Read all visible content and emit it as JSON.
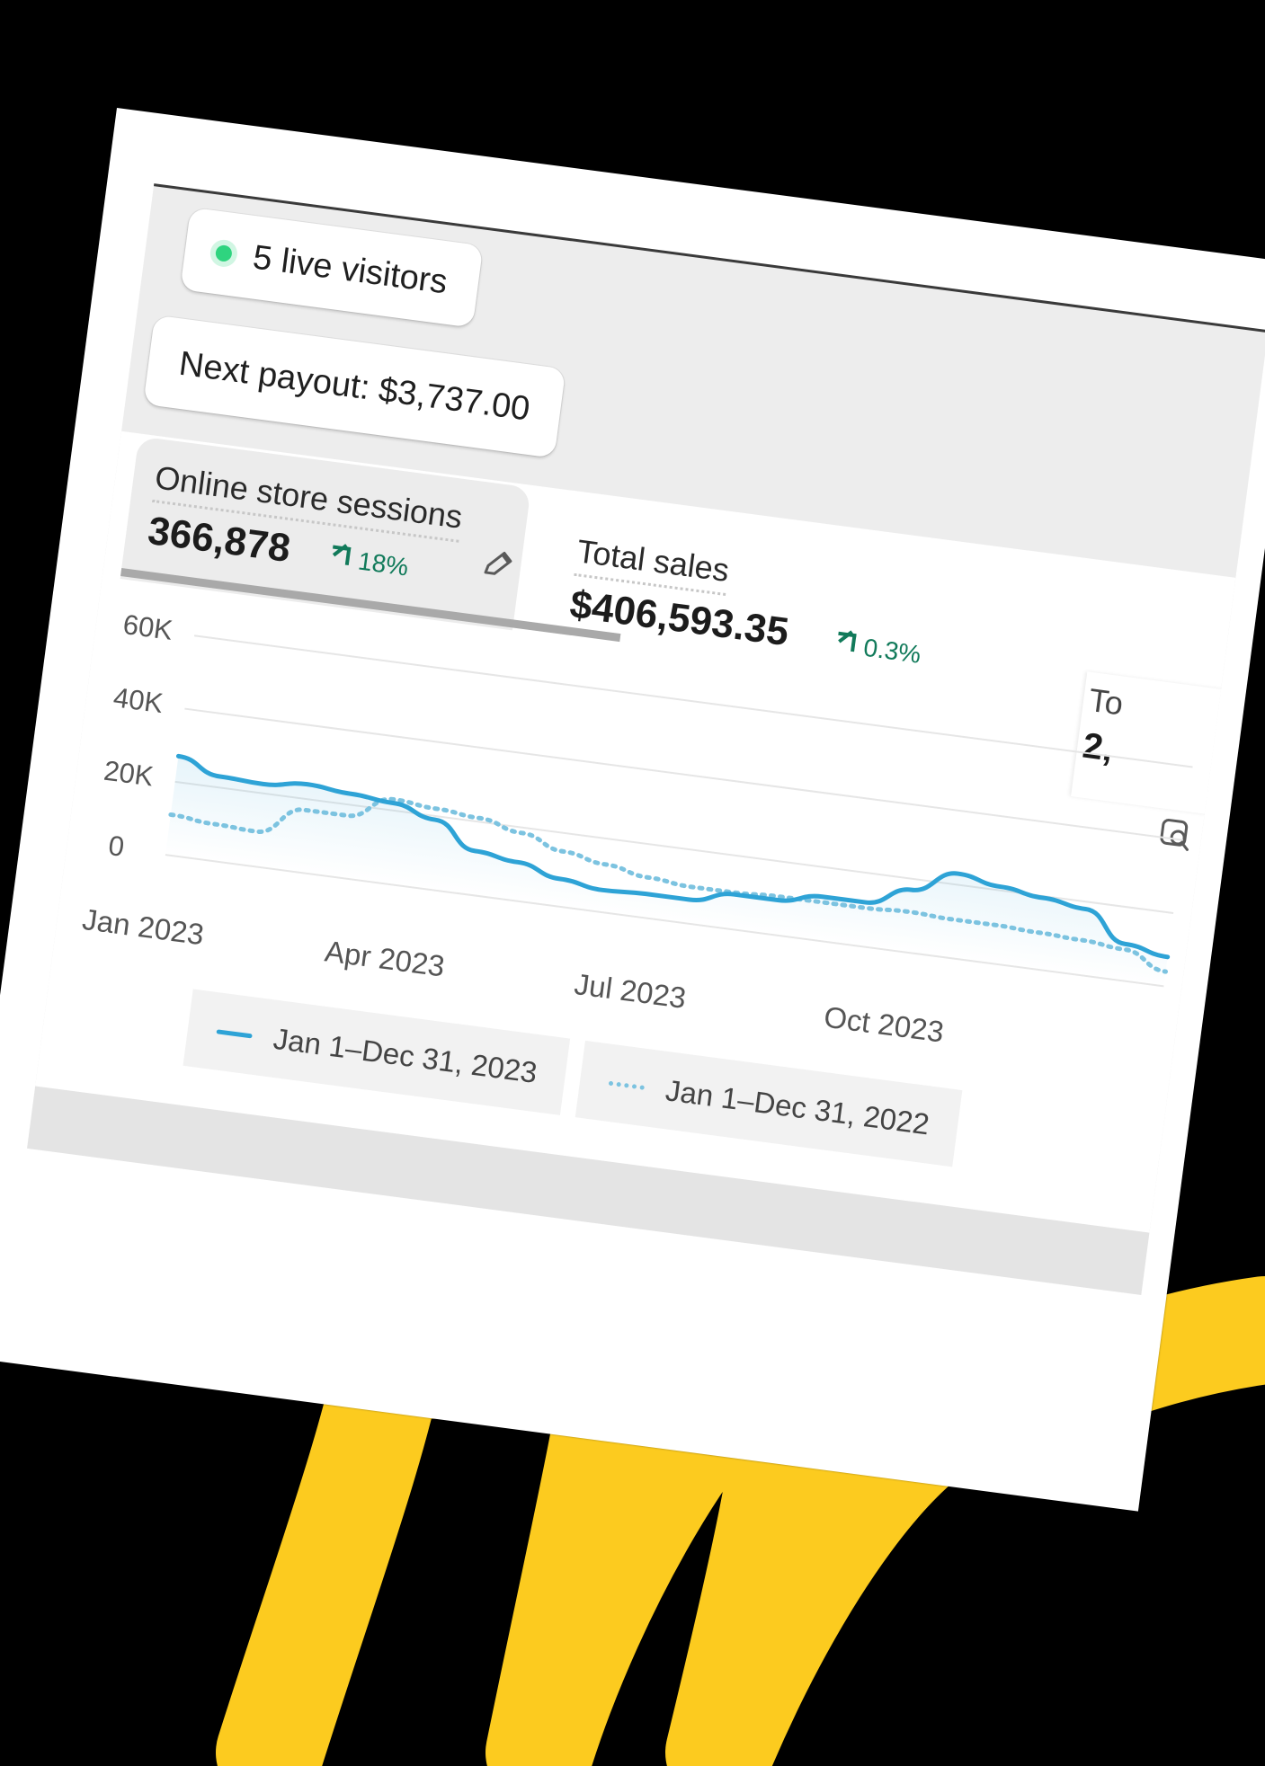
{
  "live_visitors": {
    "label": "5 live visitors",
    "status_color": "#2fd47f"
  },
  "payout": {
    "label": "Next payout: $3,737.00"
  },
  "metrics": [
    {
      "label": "Online store sessions",
      "value": "366,878",
      "change": "18%",
      "active": true
    },
    {
      "label": "Total sales",
      "value": "$406,593.35",
      "change": "0.3%",
      "active": false
    },
    {
      "label": "To",
      "value": "2,",
      "active": false
    }
  ],
  "icons": {
    "edit": "pencil-icon",
    "chart_action": "report-search-icon",
    "trend": "arrow-up-right-icon"
  },
  "colors": {
    "series_current": "#2ea3d6",
    "series_previous": "#7cc3e0",
    "positive_change": "#117a5a",
    "scribble": "#fccb1f"
  },
  "chart_data": {
    "type": "line",
    "x_ticks": [
      "Jan 2023",
      "Apr 2023",
      "Jul 2023",
      "Oct 2023"
    ],
    "y_ticks": [
      "60K",
      "40K",
      "20K",
      "0"
    ],
    "ylim": [
      0,
      60000
    ],
    "x": [
      0,
      0.5,
      1,
      1.5,
      2,
      2.5,
      3,
      3.5,
      4,
      4.5,
      5,
      5.5,
      6,
      6.5,
      7,
      7.5,
      8,
      8.5,
      9,
      9.5,
      10,
      10.5,
      11,
      11.5
    ],
    "series": [
      {
        "name": "Jan 1–Dec 31, 2023",
        "style": "solid",
        "values": [
          27000,
          23000,
          22500,
          24000,
          23000,
          22000,
          19000,
          12000,
          10500,
          7500,
          6000,
          6500,
          6500,
          9500,
          9500,
          12000,
          12000,
          17000,
          23000,
          21000,
          19500,
          18000,
          10000,
          8000
        ]
      },
      {
        "name": "Jan 1–Dec 31, 2022",
        "style": "dotted",
        "values": [
          11000,
          10000,
          9500,
          17000,
          17000,
          23000,
          22000,
          21000,
          18500,
          15000,
          13000,
          11000,
          10000,
          10000,
          10500,
          10500,
          10500,
          11000,
          10500,
          10500,
          10000,
          9500,
          8500,
          4000
        ]
      }
    ]
  }
}
